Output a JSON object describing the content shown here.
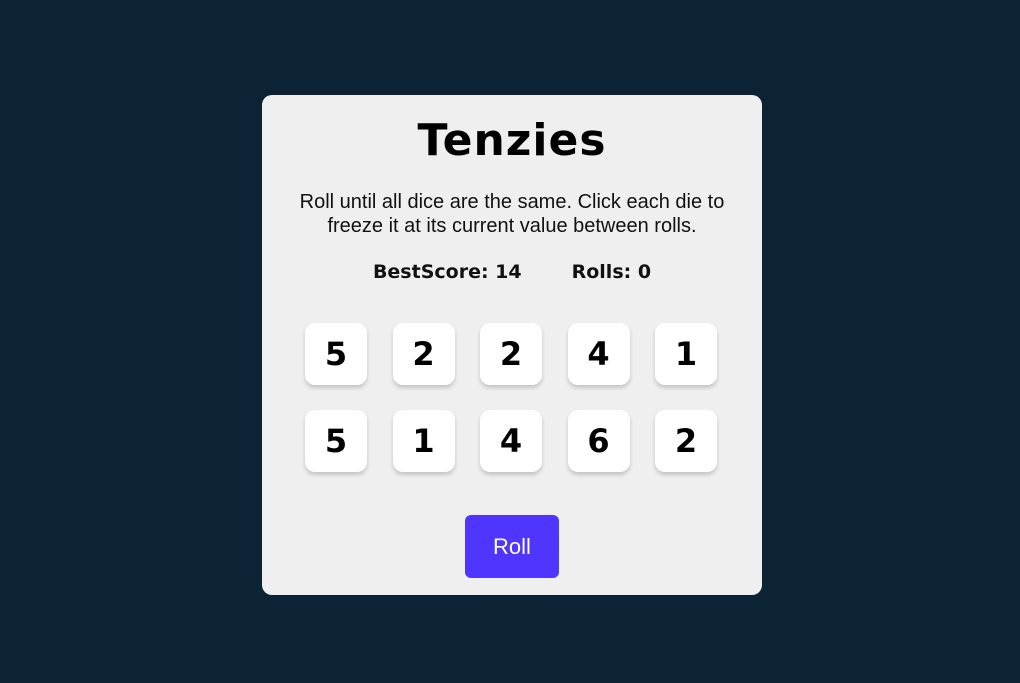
{
  "game": {
    "title": "Tenzies",
    "instructions": "Roll until all dice are the same. Click each die to freeze it at its current value between rolls.",
    "best_score_text": "BestScore: 14",
    "rolls_text": "Rolls: 0",
    "dice": [
      "5",
      "2",
      "2",
      "4",
      "1",
      "5",
      "1",
      "4",
      "6",
      "2"
    ],
    "roll_button_label": "Roll"
  },
  "colors": {
    "background": "#0b2334",
    "board": "#f0eff0",
    "die": "#ffffff",
    "roll_button": "#5035ff"
  }
}
